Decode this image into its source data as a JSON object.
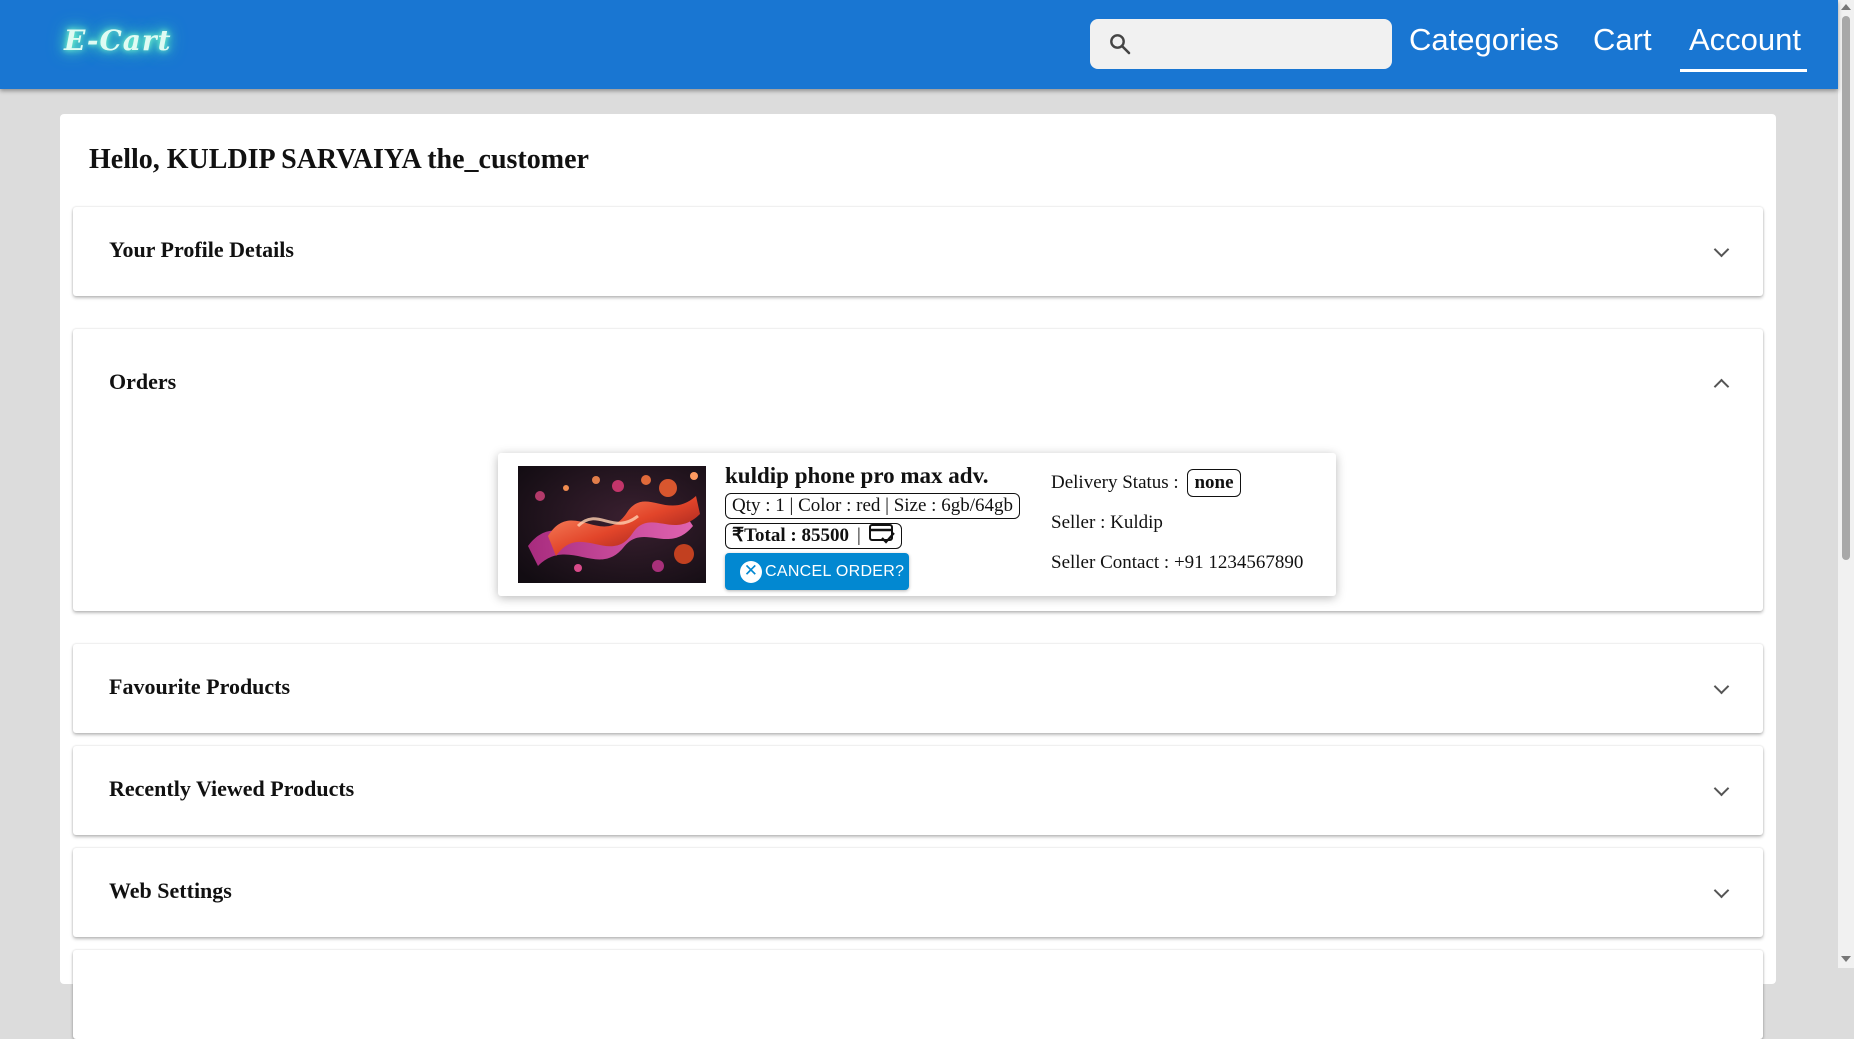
{
  "header": {
    "logo": "E-Cart",
    "search": {
      "placeholder": "",
      "value": ""
    },
    "nav": [
      {
        "label": "Categories",
        "active": false
      },
      {
        "label": "Cart",
        "active": false
      },
      {
        "label": "Account",
        "active": true
      }
    ],
    "color": "#1976d2"
  },
  "greeting": "Hello, KULDIP SARVAIYA the_customer",
  "panels": {
    "profile": {
      "title": "Your Profile Details",
      "expanded": false
    },
    "orders": {
      "title": "Orders",
      "expanded": true
    },
    "favourites": {
      "title": "Favourite Products",
      "expanded": false
    },
    "recent": {
      "title": "Recently Viewed Products",
      "expanded": false
    },
    "settings": {
      "title": "Web Settings",
      "expanded": false
    }
  },
  "order": {
    "product_name": "kuldip phone pro max adv.",
    "details": "Qty : 1 | Color : red | Size : 6gb/64gb",
    "total": "₹Total : 85500",
    "separator": "|",
    "payment_icon": "card-check-icon",
    "cancel_label": "CANCEL ORDER?",
    "delivery_label": "Delivery Status :",
    "delivery_status": "none",
    "seller": "Seller : Kuldip",
    "seller_contact": "Seller Contact : +91 1234567890",
    "button_color": "#0288d1"
  }
}
